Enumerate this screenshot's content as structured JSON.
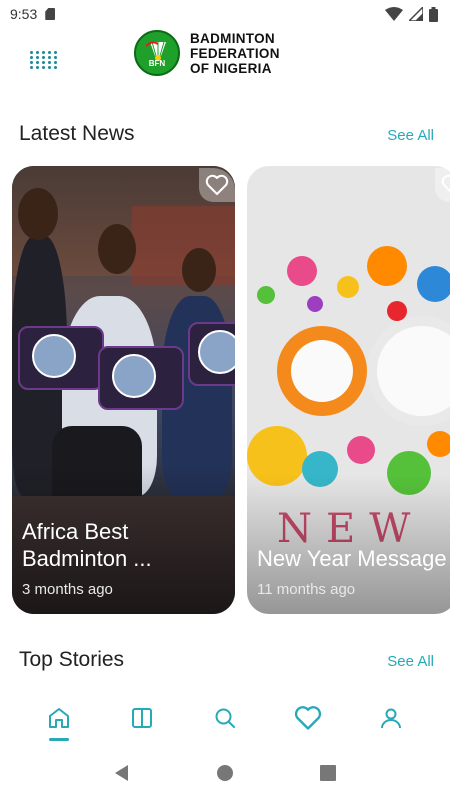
{
  "status_bar": {
    "time": "9:53",
    "icons": [
      "sd-card-icon",
      "wifi-icon",
      "signal-icon",
      "battery-icon"
    ]
  },
  "header": {
    "menu_icon": "grid-dots-icon",
    "logo_badge_text": "BFN",
    "logo_lines": [
      "BADMINTON",
      "FEDERATION",
      "OF NIGERIA"
    ]
  },
  "latest_news": {
    "title": "Latest News",
    "see_all": "See All",
    "cards": [
      {
        "title": "Africa Best Badminton ...",
        "time": "3 months ago"
      },
      {
        "title": "New Year Message",
        "time": "11 months ago"
      }
    ]
  },
  "top_stories": {
    "title": "Top Stories",
    "see_all": "See All"
  },
  "bottom_nav": {
    "items": [
      "home-icon",
      "book-icon",
      "search-icon",
      "heart-icon",
      "profile-icon"
    ],
    "active": "home-icon"
  },
  "system_nav": {
    "items": [
      "back-icon",
      "home-circle-icon",
      "recents-icon"
    ]
  },
  "colors": {
    "accent": "#28a9b8",
    "logo_green": "#1fa02b"
  }
}
